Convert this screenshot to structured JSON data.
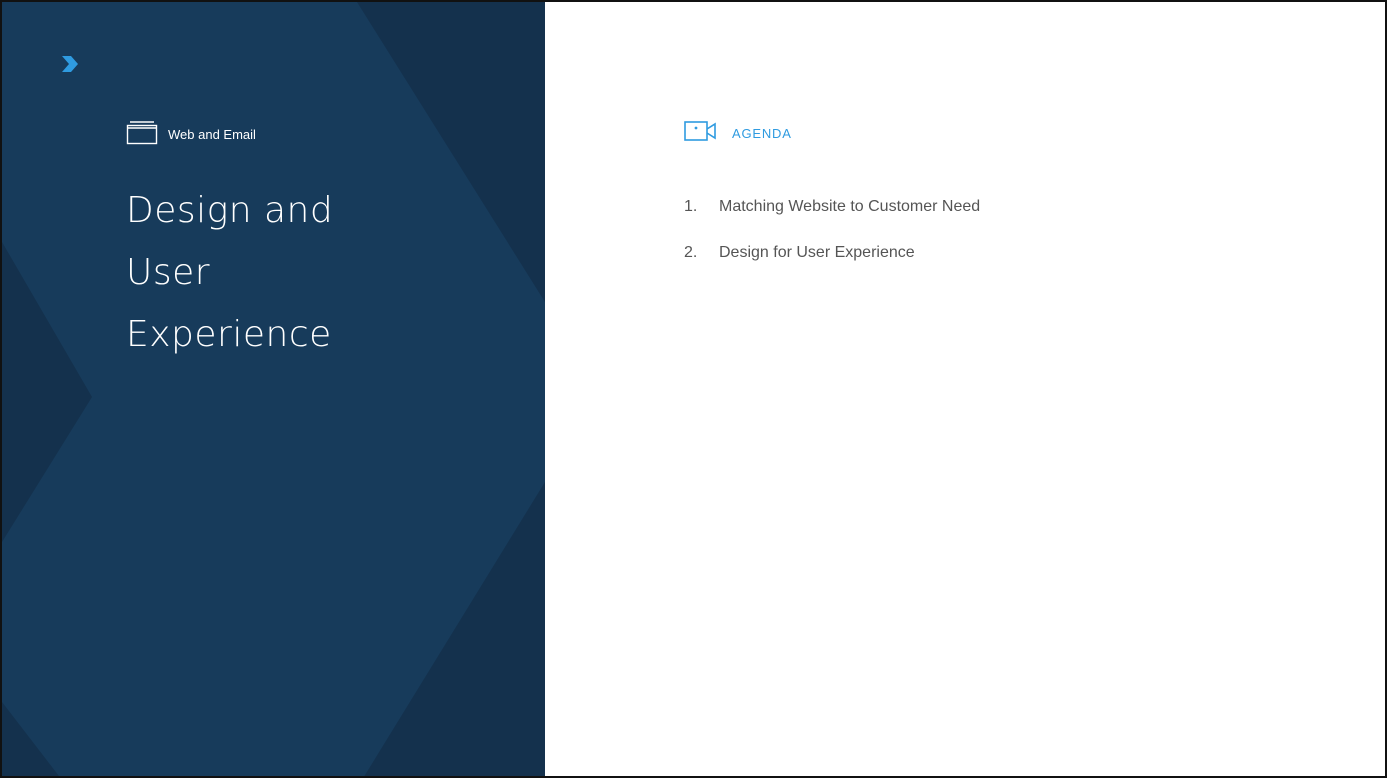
{
  "section": {
    "label": "Web and Email",
    "icon": "folder-tab-icon"
  },
  "title": {
    "lines": [
      "Design and",
      "User",
      "Experience"
    ]
  },
  "agenda": {
    "label": "AGENDA",
    "icon": "video-camera-icon",
    "items": [
      {
        "number": "1.",
        "text": "Matching Website to Customer Need"
      },
      {
        "number": "2.",
        "text": "Design for User Experience"
      }
    ]
  },
  "colors": {
    "panel_background": "#173b5b",
    "panel_shade": "#132f4a",
    "accent_blue": "#2f9be0",
    "body_text": "#555555"
  },
  "logo": {
    "icon": "chevron-logo-icon"
  }
}
